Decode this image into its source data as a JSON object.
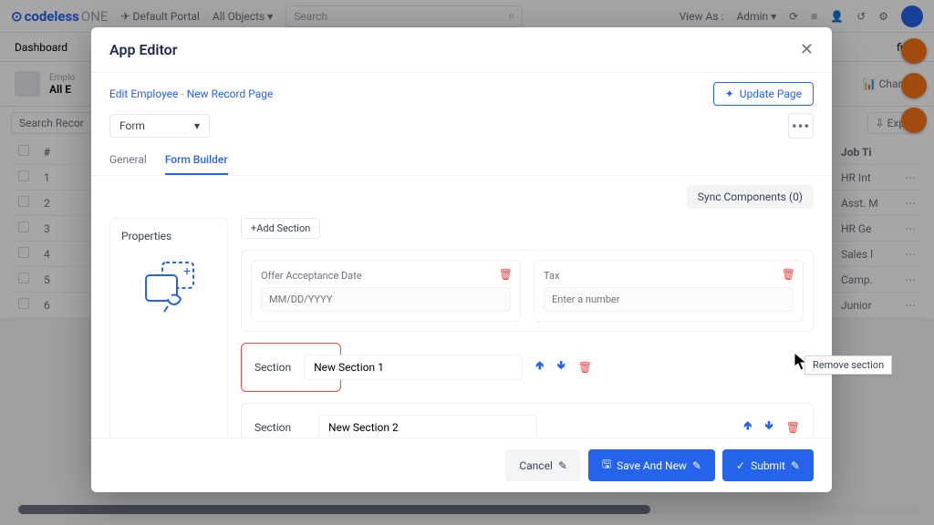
{
  "brand": {
    "a": "codeless",
    "b": "ONE"
  },
  "topbar": {
    "portal": "Default Portal",
    "allObjects": "All Objects ▾",
    "searchPlaceholder": "Search",
    "viewAs": "View As :",
    "role": "Admin"
  },
  "subbar": {
    "dashboard": "Dashboard",
    "file": "file ▾"
  },
  "pagehead": {
    "small": "Emplo",
    "big": "All E",
    "charts": "Charts ▾"
  },
  "filter": {
    "search": "Search Recor",
    "export": "Expor"
  },
  "table": {
    "cols": [
      "#",
      "Job Ti"
    ],
    "rows": [
      [
        "1",
        "HR Int"
      ],
      [
        "2",
        "Asst. M"
      ],
      [
        "3",
        "HR Ge"
      ],
      [
        "4",
        "Sales l"
      ],
      [
        "5",
        "Camp."
      ],
      [
        "6",
        "Junior"
      ]
    ]
  },
  "modal": {
    "title": "App Editor",
    "breadcrumb": {
      "a": "Edit",
      "b": "Employee",
      "c": "New Record",
      "d": "Page"
    },
    "update": "Update Page",
    "selector": "Form",
    "tabs": {
      "general": "General",
      "builder": "Form Builder"
    },
    "sync": "Sync Components (0)",
    "properties": "Properties",
    "addSection": "+Add Section",
    "field1": {
      "label": "Offer Acceptance Date",
      "ph": "MM/DD/YYYY"
    },
    "field2": {
      "label": "Tax",
      "ph": "Enter a number"
    },
    "sectionLabel": "Section",
    "section1": "New Section 1",
    "section2": "New Section 2",
    "footer": {
      "cancel": "Cancel",
      "saveNew": "Save And New",
      "submit": "Submit"
    }
  },
  "tooltip": "Remove section"
}
